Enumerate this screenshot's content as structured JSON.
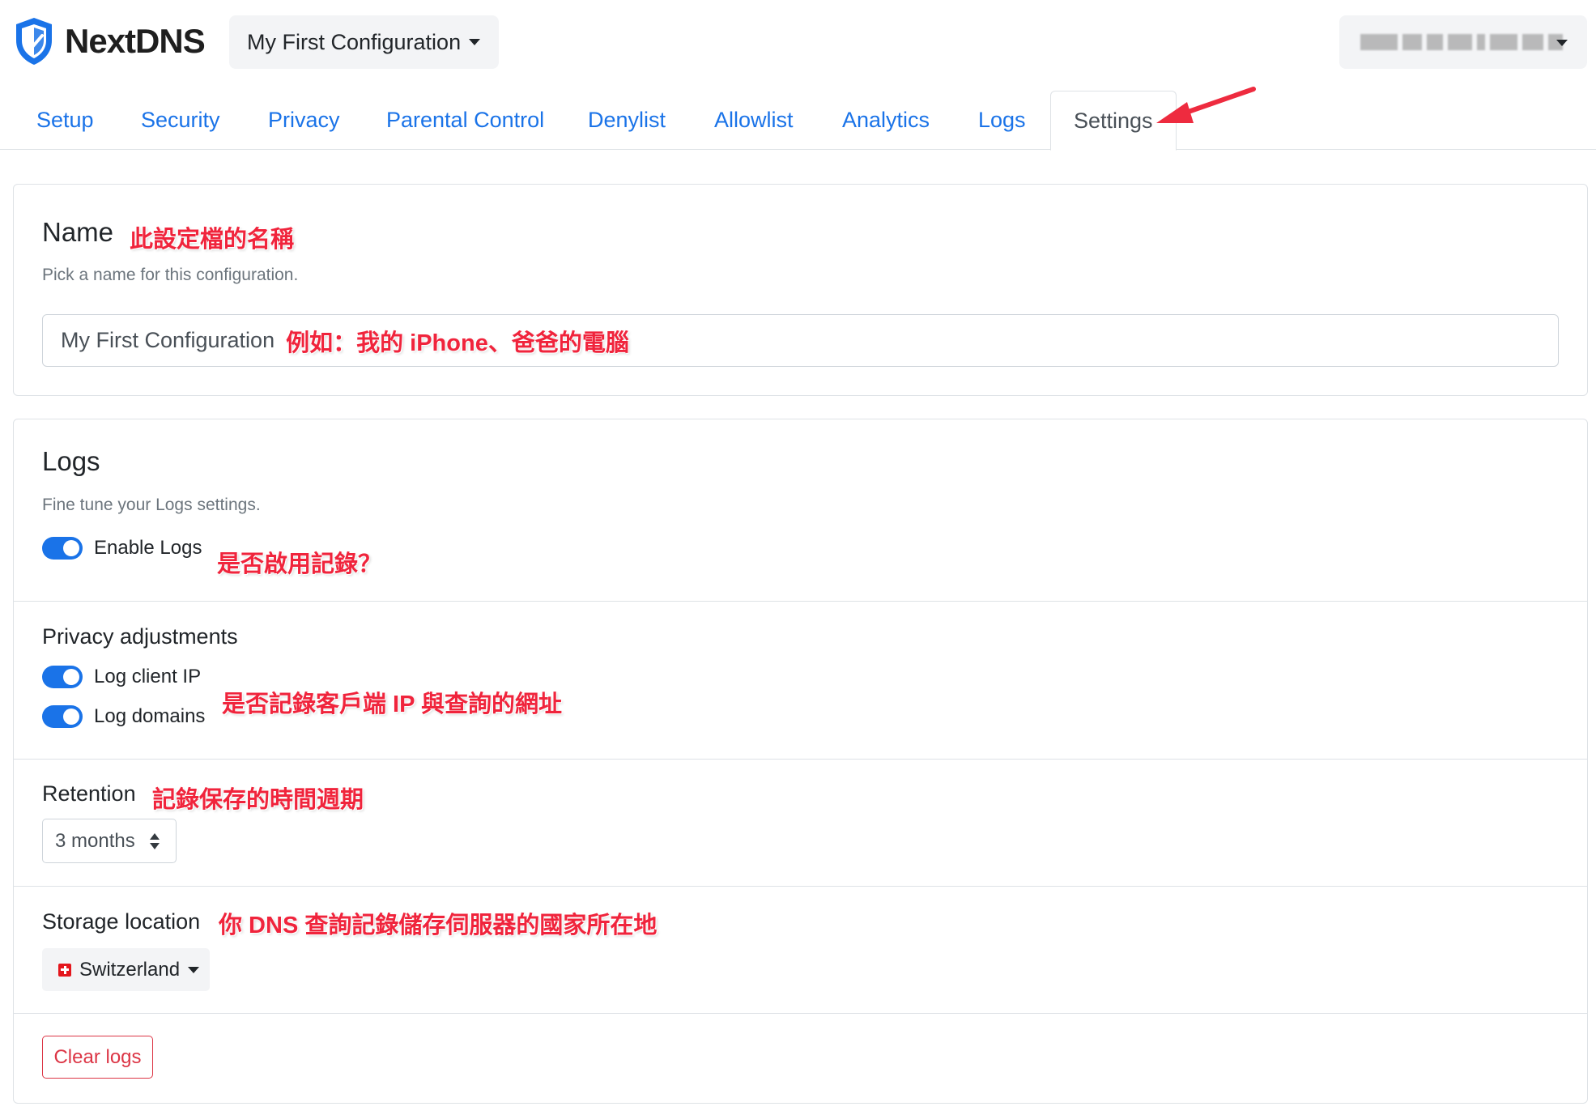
{
  "header": {
    "brand": "NextDNS",
    "config_selector": "My First Configuration",
    "account_label_hidden": "blurred-account-email"
  },
  "tabs": [
    {
      "label": "Setup",
      "active": false
    },
    {
      "label": "Security",
      "active": false
    },
    {
      "label": "Privacy",
      "active": false
    },
    {
      "label": "Parental Control",
      "active": false
    },
    {
      "label": "Denylist",
      "active": false
    },
    {
      "label": "Allowlist",
      "active": false
    },
    {
      "label": "Analytics",
      "active": false
    },
    {
      "label": "Logs",
      "active": false
    },
    {
      "label": "Settings",
      "active": true
    }
  ],
  "name_section": {
    "title": "Name",
    "annotation": "此設定檔的名稱",
    "description": "Pick a name for this configuration.",
    "input_value": "My First Configuration",
    "input_annotation": "例如：我的 iPhone、爸爸的電腦"
  },
  "logs_section": {
    "title": "Logs",
    "description": "Fine tune your Logs settings.",
    "enable_logs": {
      "label": "Enable Logs",
      "checked": true,
      "annotation": "是否啟用記錄？"
    },
    "privacy": {
      "title": "Privacy adjustments",
      "log_client_ip": {
        "label": "Log client IP",
        "checked": true
      },
      "log_domains": {
        "label": "Log domains",
        "checked": true
      },
      "annotation": "是否記錄客戶端 IP 與查詢的網址"
    },
    "retention": {
      "title": "Retention",
      "annotation": "記錄保存的時間週期",
      "selected": "3 months"
    },
    "storage": {
      "title": "Storage location",
      "annotation": "你 DNS 查詢記錄儲存伺服器的國家所在地",
      "selected": "Switzerland"
    },
    "clear_button": "Clear logs"
  },
  "colors": {
    "link_blue": "#1a73e8",
    "annotation_red": "#f0243c",
    "danger": "#dc3545",
    "arrow_red": "#ee2b3f"
  }
}
